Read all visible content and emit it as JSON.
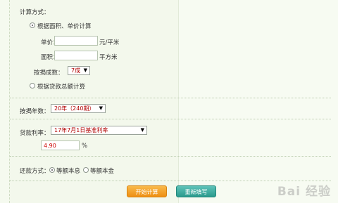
{
  "calc_method": {
    "label": "计算方式：",
    "option_area": "根据面积、单价计算",
    "option_total": "根据贷款总额计算",
    "unit_price_label": "单价：",
    "unit_price_unit": "元/平米",
    "unit_price_value": "",
    "area_label": "面积：",
    "area_unit": "平方米",
    "area_value": "",
    "ratio_label": "按揭成数：",
    "ratio_value": "7成"
  },
  "term": {
    "label": "按揭年数：",
    "value": "20年（240期）"
  },
  "rate": {
    "label": "贷款利率：",
    "value": "17年7月1日基准利率",
    "input_value": "4.90",
    "unit": "%"
  },
  "repay": {
    "label": "还款方式：",
    "option_equal_payment": "等额本息",
    "option_equal_principal": "等额本金"
  },
  "buttons": {
    "start": "开始计算",
    "reset": "重新填写"
  },
  "watermark": "Bai 经验"
}
